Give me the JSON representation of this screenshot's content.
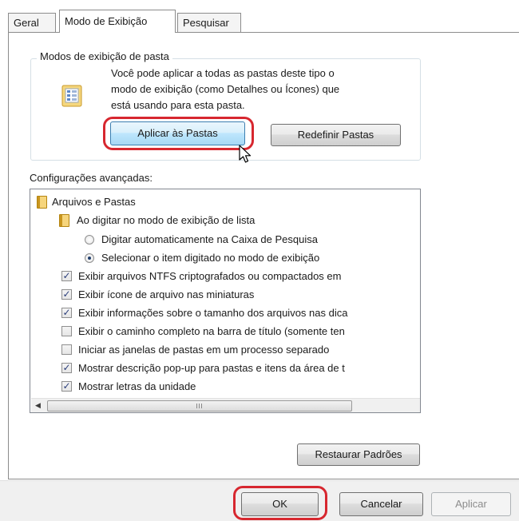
{
  "tabs": [
    {
      "label": "Geral"
    },
    {
      "label": "Modo de Exibição"
    },
    {
      "label": "Pesquisar"
    }
  ],
  "folder_views": {
    "title": "Modos de exibição de pasta",
    "description_lines": [
      "Você pode aplicar a todas as pastas deste tipo o",
      "modo de exibição (como Detalhes ou Ícones) que",
      "está usando para esta pasta."
    ],
    "apply_button": "Aplicar às Pastas",
    "reset_button": "Redefinir Pastas"
  },
  "advanced": {
    "label": "Configurações avançadas:",
    "items": [
      {
        "type": "folder",
        "label": "Arquivos e Pastas"
      },
      {
        "type": "folder",
        "label": "Ao digitar no modo de exibição de lista"
      },
      {
        "type": "radio",
        "checked": false,
        "label": "Digitar automaticamente na Caixa de Pesquisa"
      },
      {
        "type": "radio",
        "checked": true,
        "label": "Selecionar o item digitado no modo de exibição"
      },
      {
        "type": "check",
        "checked": true,
        "label": "Exibir arquivos NTFS criptografados ou compactados em"
      },
      {
        "type": "check",
        "checked": true,
        "label": "Exibir ícone de arquivo nas miniaturas"
      },
      {
        "type": "check",
        "checked": true,
        "label": "Exibir informações sobre o tamanho dos arquivos nas dica"
      },
      {
        "type": "check",
        "checked": false,
        "label": "Exibir o caminho completo na barra de título (somente ten"
      },
      {
        "type": "check",
        "checked": false,
        "label": "Iniciar as janelas de pastas em um processo separado"
      },
      {
        "type": "check",
        "checked": true,
        "label": "Mostrar descrição pop-up para pastas e itens da área de t"
      },
      {
        "type": "check",
        "checked": true,
        "label": "Mostrar letras da unidade"
      }
    ]
  },
  "restore_button": "Restaurar Padrões",
  "footer": {
    "ok": "OK",
    "cancel": "Cancelar",
    "apply": "Aplicar"
  },
  "colors": {
    "highlight": "#d7272f",
    "accent": "#3c7fb1"
  }
}
